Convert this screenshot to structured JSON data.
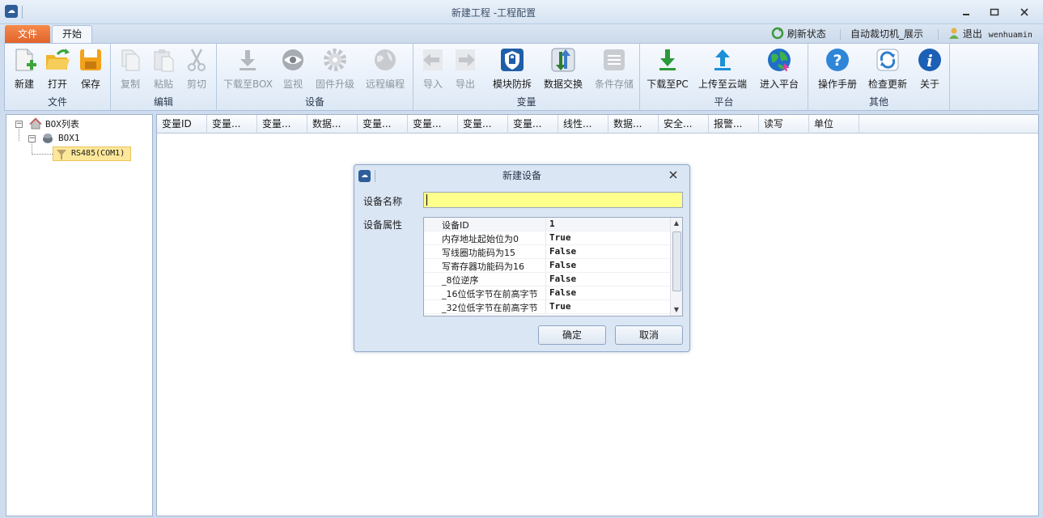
{
  "window": {
    "title": "新建工程 -工程配置",
    "app_icon_glyph": "☁"
  },
  "tabs": {
    "file": "文件",
    "start": "开始"
  },
  "topright": {
    "refresh": "刷新状态",
    "project": "自动裁切机_展示",
    "logout": "退出",
    "user": "wenhuamin"
  },
  "ribbon": {
    "groups": [
      {
        "label": "文件",
        "buttons": [
          {
            "label": "新建",
            "icon": "new-file-icon"
          },
          {
            "label": "打开",
            "icon": "open-folder-icon"
          },
          {
            "label": "保存",
            "icon": "save-icon"
          }
        ]
      },
      {
        "label": "编辑",
        "buttons": [
          {
            "label": "复制",
            "icon": "copy-icon"
          },
          {
            "label": "粘贴",
            "icon": "paste-icon"
          },
          {
            "label": "剪切",
            "icon": "scissors-icon"
          }
        ]
      },
      {
        "label": "设备",
        "buttons": [
          {
            "label": "下载至BOX",
            "icon": "download-box-icon"
          },
          {
            "label": "监视",
            "icon": "eye-icon"
          },
          {
            "label": "固件升级",
            "icon": "gear-icon"
          },
          {
            "label": "远程编程",
            "icon": "globe-icon"
          }
        ]
      },
      {
        "label": "变量",
        "buttons": [
          {
            "label": "导入",
            "icon": "import-arrow-icon"
          },
          {
            "label": "导出",
            "icon": "export-arrow-icon"
          },
          {
            "label": "模块防拆",
            "icon": "shield-lock-icon"
          },
          {
            "label": "数据交换",
            "icon": "exchange-arrows-icon"
          },
          {
            "label": "条件存储",
            "icon": "list-storage-icon"
          }
        ]
      },
      {
        "label": "平台",
        "buttons": [
          {
            "label": "下载至PC",
            "icon": "download-pc-icon"
          },
          {
            "label": "上传至云端",
            "icon": "upload-cloud-icon"
          },
          {
            "label": "进入平台",
            "icon": "platform-globe-icon"
          }
        ]
      },
      {
        "label": "其他",
        "buttons": [
          {
            "label": "操作手册",
            "icon": "help-icon"
          },
          {
            "label": "检查更新",
            "icon": "refresh-icon"
          },
          {
            "label": "关于",
            "icon": "info-icon"
          }
        ]
      }
    ]
  },
  "tree": {
    "root": "BOX列表",
    "box": "BOX1",
    "port": "RS485(COM1)"
  },
  "table": {
    "columns": [
      "变量ID",
      "变量...",
      "变量...",
      "数据...",
      "变量...",
      "变量...",
      "变量...",
      "变量...",
      "线性...",
      "数据...",
      "安全...",
      "报警...",
      "读写",
      "单位"
    ]
  },
  "dialog": {
    "title": "新建设备",
    "name_label": "设备名称",
    "name_value": "",
    "props_label": "设备属性",
    "properties": [
      {
        "name": "设备ID",
        "value": "1"
      },
      {
        "name": "内存地址起始位为0",
        "value": "True"
      },
      {
        "name": "写线圈功能码为15",
        "value": "False"
      },
      {
        "name": "写寄存器功能码为16",
        "value": "False"
      },
      {
        "name": "_8位逆序",
        "value": "False"
      },
      {
        "name": "_16位低字节在前高字节",
        "value": "False"
      },
      {
        "name": "_32位低字节在前高字节",
        "value": "True"
      }
    ],
    "ok": "确定",
    "cancel": "取消"
  }
}
